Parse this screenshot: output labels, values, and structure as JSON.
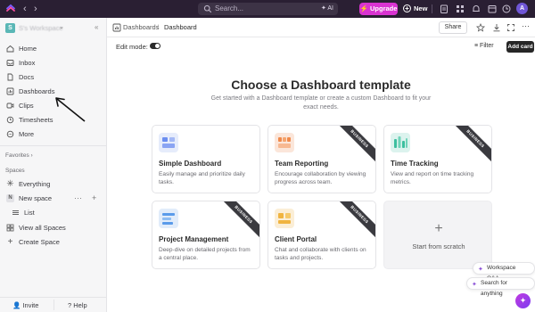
{
  "topbar": {
    "search_placeholder": "Search...",
    "ai_label": "AI",
    "upgrade_label": "Upgrade",
    "new_label": "New",
    "avatar_initial": "A"
  },
  "sidebar": {
    "workspace_badge": "S",
    "workspace_name": "S's Workspace",
    "items": [
      {
        "label": "Home",
        "icon": "home-icon"
      },
      {
        "label": "Inbox",
        "icon": "inbox-icon"
      },
      {
        "label": "Docs",
        "icon": "docs-icon"
      },
      {
        "label": "Dashboards",
        "icon": "dashboards-icon"
      },
      {
        "label": "Clips",
        "icon": "clips-icon"
      },
      {
        "label": "Timesheets",
        "icon": "timesheets-icon"
      },
      {
        "label": "More",
        "icon": "more-icon"
      }
    ],
    "favorites_label": "Favorites",
    "spaces_label": "Spaces",
    "spaces": {
      "everything": "Everything",
      "new_space": "New space",
      "new_space_badge": "N",
      "list": "List",
      "view_all": "View all Spaces",
      "create": "Create Space"
    },
    "invite_label": "Invite",
    "help_label": "Help"
  },
  "header": {
    "breadcrumb_root": "Dashboards",
    "breadcrumb_sep": "/",
    "breadcrumb_current": "Dashboard",
    "share_label": "Share",
    "edit_mode_label": "Edit mode:",
    "filter_label": "Filter",
    "add_card_label": "Add card"
  },
  "main": {
    "title": "Choose a Dashboard template",
    "subtitle": "Get started with a Dashboard template or create a custom Dashboard to fit your exact needs."
  },
  "templates": [
    {
      "name": "Simple Dashboard",
      "desc": "Easily manage and prioritize daily tasks.",
      "business": false,
      "thumb_color": "#e6ecfb"
    },
    {
      "name": "Team Reporting",
      "desc": "Encourage collaboration by viewing progress across team.",
      "business": true,
      "thumb_color": "#fbe6da"
    },
    {
      "name": "Time Tracking",
      "desc": "View and report on time tracking metrics.",
      "business": true,
      "thumb_color": "#dcf3ee"
    },
    {
      "name": "Project Management",
      "desc": "Deep-dive on detailed projects from a central place.",
      "business": true,
      "thumb_color": "#e1ecfa"
    },
    {
      "name": "Client Portal",
      "desc": "Chat and collaborate with clients on tasks and projects.",
      "business": true,
      "thumb_color": "#fbeed6"
    }
  ],
  "business_label": "BUSINESS",
  "scratch_label": "Start from scratch",
  "floating": {
    "workspace_qa": "Workspace Q&A",
    "search_anything": "Search for anything"
  },
  "colors": {
    "topbar_bg": "#2a1f33",
    "upgrade": "#d933d1",
    "add_card": "#262626"
  }
}
